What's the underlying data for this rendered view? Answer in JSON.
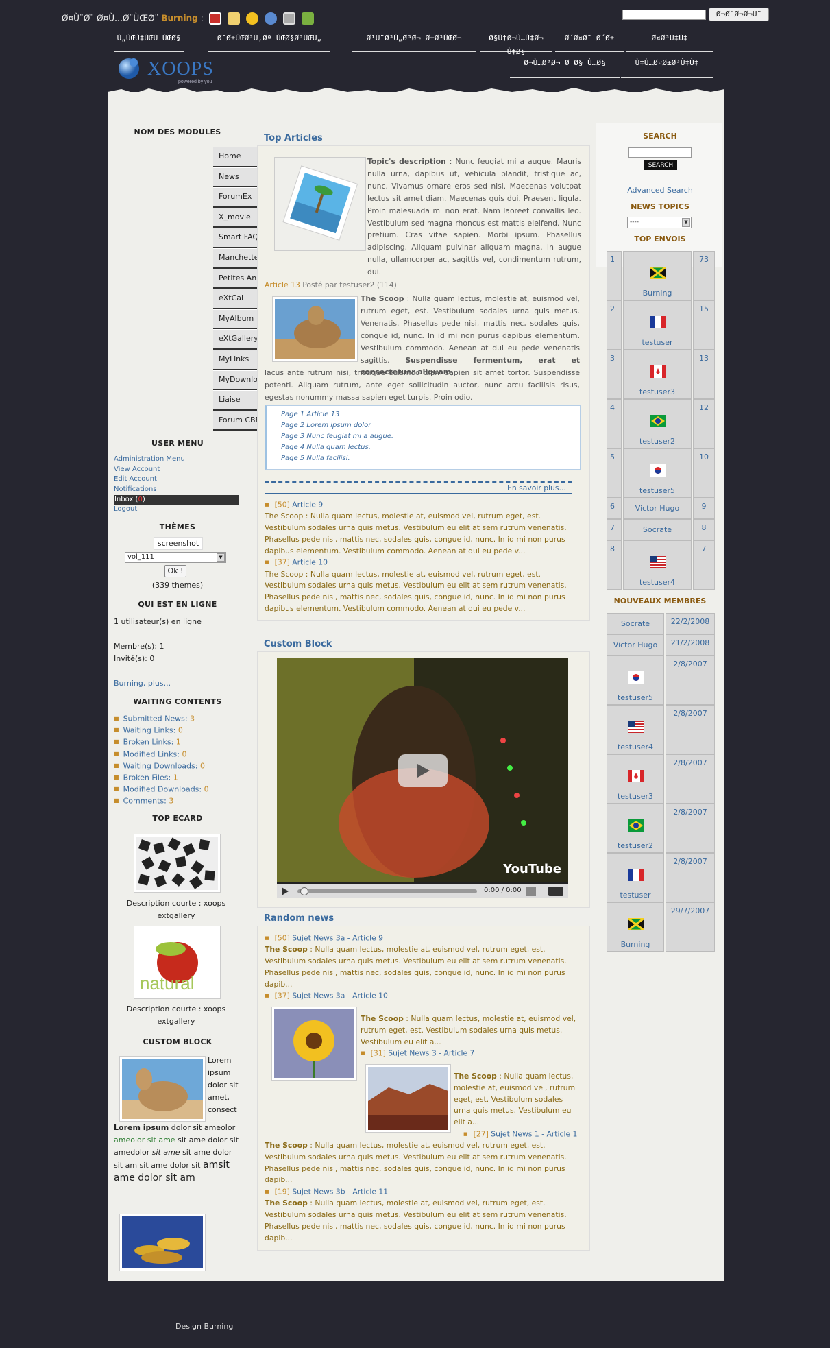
{
  "topbar": {
    "welcome_text": "Ø¤Ù¨Ø¨ Ø¤Ù…Ø¨ÙŒØ¨",
    "username": "Burning",
    "separator": ":",
    "search_button": "Ø¬Ø¨Ø¬Ø¬Ù¨",
    "icons": [
      "mail-icon",
      "notes-icon",
      "chat-icon",
      "search-icon",
      "monitor-icon",
      "download-icon"
    ]
  },
  "nav": {
    "row1": [
      "Ù„ÙŒÙ‡ÙŒÙ ÙŒØ§",
      "Ø¯Ø±ÙŒØ³Ù‚Øª ÙŒØ§Ø³ÙŒÙ„",
      "Ø¹Ù¨Ø³Ù„Ø³Ø¬ Ø±Ø³ÙŒØ¬",
      "Ø§Ù†Ø¬Ù…Ù‡Ø¬ Ù‡Ø§",
      "Ø´Ø¤Ø¯ Ø´Ø±",
      "Ø¤Ø³Ù‡Ù‡"
    ],
    "row2": [
      "Ø¬Ù…Ø³Ø¬ Ø¨Ø§ Ù…Ø§",
      "Ù‡Ù…Ø¤Ø±Ø³Ù‡Ù‡"
    ]
  },
  "logo": {
    "text": "XOOPS",
    "tagline": "powered by you"
  },
  "left": {
    "modules_title": "NOM DES MODULES",
    "modules": [
      "Home",
      "News",
      "ForumEx",
      "X_movie",
      "Smart FAQ",
      "Manchettes0",
      "Petites Annonces",
      "eXtCal",
      "MyAlbum",
      "eXtGallery",
      "MyLinks",
      "MyDownloads",
      "Liaise",
      "Forum CBB"
    ],
    "user_menu_title": "USER MENU",
    "user_menu": [
      "Administration Menu",
      "View Account",
      "Edit Account",
      "Notifications"
    ],
    "inbox_label": "Inbox (",
    "inbox_count": "0",
    "inbox_close": ")",
    "logout": "Logout",
    "themes_title": "THÈMES",
    "theme_preview": "screenshot",
    "theme_selected": "vol_111",
    "theme_ok": "Ok !",
    "theme_count": "(339 themes)",
    "online_title": "QUI EST EN LIGNE",
    "online_users": "1 utilisateur(s) en ligne",
    "members": "Membre(s): 1",
    "guests": "Invité(s): 0",
    "online_link": "Burning",
    "online_more": "plus...",
    "waiting_title": "WAITING CONTENTS",
    "waiting": [
      {
        "label": "Submitted News:",
        "num": "3"
      },
      {
        "label": "Waiting Links:",
        "num": "0"
      },
      {
        "label": "Broken Links:",
        "num": "1"
      },
      {
        "label": "Modified Links:",
        "num": "0"
      },
      {
        "label": "Waiting Downloads:",
        "num": "0"
      },
      {
        "label": "Broken Files:",
        "num": "1"
      },
      {
        "label": "Modified Downloads:",
        "num": "0"
      },
      {
        "label": "Comments:",
        "num": "3"
      }
    ],
    "ecard_title": "TOP ECARD",
    "ecard_caption1": "Description courte : xoops extgallery",
    "ecard_caption2": "Description courte : xoops extgallery",
    "ecard2_word": "natural",
    "custom_title": "CUSTOM BLOCK",
    "custom_text": "Lorem ipsum dolor sit amet, consectetuer adipiscing elit.",
    "custom_bold": "Lorem ipsum",
    "custom_tail1": "dolor sit ameolor",
    "custom_green": "ameolor sit ame",
    "custom_tail2": "sit ame dolor sit amedolor",
    "custom_italic": "sit ame",
    "custom_tail3": "sit ame dolor sit am sit ame dolor sit",
    "custom_large": "amsit ame dolor sit am"
  },
  "center": {
    "top_title": "Top Articles",
    "topic_label": "Topic's description",
    "topic_text": "Nunc feugiat mi a augue. Mauris nulla urna, dapibus ut, vehicula blandit, tristique ac, nunc. Vivamus ornare eros sed nisl. Maecenas volutpat lectus sit amet diam. Maecenas quis dui. Praesent ligula. Proin malesuada mi non erat. Nam laoreet convallis leo. Vestibulum sed magna rhoncus est mattis eleifend. Nunc pretium. Cras vitae sapien. Morbi ipsum. Phasellus adipiscing. Aliquam pulvinar aliquam magna. In augue nulla, ullamcorper ac, sagittis vel, condimentum rutrum, dui.",
    "article_label": "Article 13",
    "article_meta": "Posté par testuser2 (114)",
    "scoop_label": "The Scoop",
    "scoop_text": "Nulla quam lectus, molestie at, euismod vel, rutrum eget, est. Vestibulum sodales urna quis metus. Venenatis. Phasellus pede nisi, mattis nec, sodales quis, congue id, nunc. In id mi non purus dapibus elementum. Vestibulum commodo. Aenean at dui eu pede venenatis sagittis.",
    "scoop_bold": "Suspendisse fermentum, erat et consectetuer aliquam,",
    "scoop_tail": "lacus ante rutrum nisi, tristique euismod diam sapien sit amet tortor. Suspendisse potenti. Aliquam rutrum, ante eget sollicitudin auctor, nunc arcu facilisis risus, egestas nonummy massa sapien eget turpis. Proin odio.",
    "pages": [
      "Page 1 Article 13",
      "Page 2 Lorem ipsum dolor",
      "Page 3 Nunc feugiat mi a augue.",
      "Page 4 Nulla quam lectus.",
      "Page 5 Nulla facilisi."
    ],
    "more": "En savoir plus...",
    "list1": [
      {
        "id": "[50]",
        "title": "Article 9"
      },
      {
        "id": "[37]",
        "title": "Article 10"
      }
    ],
    "list_body": "The Scoop : Nulla quam lectus, molestie at, euismod vel, rutrum eget, est. Vestibulum sodales urna quis metus. Vestibulum eu elit at sem rutrum venenatis. Phasellus pede nisi, mattis nec, sodales quis, congue id, nunc. In id mi non purus dapibus elementum. Vestibulum commodo. Aenean at dui eu pede v...",
    "custom_title": "Custom Block",
    "video_time": "0:00 / 0:00",
    "video_brand": "YouTube",
    "random_title": "Random news",
    "random": [
      {
        "id": "[50]",
        "cat": "Sujet News 3a",
        "title": "Article 9"
      },
      {
        "id": "[37]",
        "cat": "Sujet News 3a",
        "title": "Article 10"
      },
      {
        "id": "[31]",
        "cat": "Sujet News 3",
        "title": "Article 7"
      },
      {
        "id": "[27]",
        "cat": "Sujet News 1",
        "title": "Article 1"
      },
      {
        "id": "[19]",
        "cat": "Sujet News 3b",
        "title": "Article 11"
      }
    ],
    "random_body": "Nulla quam lectus, molestie at, euismod vel, rutrum eget, est. Vestibulum sodales urna quis metus. Vestibulum eu elit at sem rutrum venenatis. Phasellus pede nisi, mattis nec, sodales quis, congue id, nunc. In id mi non purus dapib...",
    "random_short": "Nulla quam lectus, molestie at, euismod vel, rutrum eget, est. Vestibulum sodales urna quis metus. Vestibulum eu elit a...",
    "random_short2": "Nulla quam lectus, molestie at, euismod vel, rutrum eget, est. Vestibulum sodales urna quis metus. Vestibulum eu elit a..."
  },
  "right": {
    "search_title": "SEARCH",
    "search_button": "SEARCH",
    "advanced": "Advanced Search",
    "topics_title": "NEWS TOPICS",
    "topics_selected": "----",
    "top_title": "TOP ENVOIS",
    "top": [
      {
        "rank": "1",
        "name": "Burning",
        "count": "73",
        "flag": "jamaica"
      },
      {
        "rank": "2",
        "name": "testuser",
        "count": "15",
        "flag": "france"
      },
      {
        "rank": "3",
        "name": "testuser3",
        "count": "13",
        "flag": "canada"
      },
      {
        "rank": "4",
        "name": "testuser2",
        "count": "12",
        "flag": "brazil"
      },
      {
        "rank": "5",
        "name": "testuser5",
        "count": "10",
        "flag": "korea"
      },
      {
        "rank": "6",
        "name": "Victor Hugo",
        "count": "9",
        "flag": ""
      },
      {
        "rank": "7",
        "name": "Socrate",
        "count": "8",
        "flag": ""
      },
      {
        "rank": "8",
        "name": "testuser4",
        "count": "7",
        "flag": "usa"
      }
    ],
    "new_title": "NOUVEAUX MEMBRES",
    "new": [
      {
        "name": "Socrate",
        "date": "22/2/2008",
        "flag": ""
      },
      {
        "name": "Victor Hugo",
        "date": "21/2/2008",
        "flag": ""
      },
      {
        "name": "testuser5",
        "date": "2/8/2007",
        "flag": "korea"
      },
      {
        "name": "testuser4",
        "date": "2/8/2007",
        "flag": "usa"
      },
      {
        "name": "testuser3",
        "date": "2/8/2007",
        "flag": "canada"
      },
      {
        "name": "testuser2",
        "date": "2/8/2007",
        "flag": "brazil"
      },
      {
        "name": "testuser",
        "date": "2/8/2007",
        "flag": "france"
      },
      {
        "name": "Burning",
        "date": "29/7/2007",
        "flag": "jamaica"
      }
    ]
  },
  "footer": "Design Burning"
}
